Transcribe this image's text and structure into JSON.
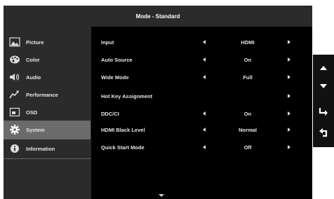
{
  "title": "Mode - Standard",
  "sidebar": {
    "items": [
      {
        "label": "Picture",
        "icon": "picture-icon"
      },
      {
        "label": "Color",
        "icon": "color-palette-icon"
      },
      {
        "label": "Audio",
        "icon": "speaker-icon"
      },
      {
        "label": "Performance",
        "icon": "performance-icon"
      },
      {
        "label": "OSD",
        "icon": "osd-icon"
      },
      {
        "label": "System",
        "icon": "gear-icon",
        "selected": true
      },
      {
        "label": "Information",
        "icon": "info-icon"
      }
    ]
  },
  "settings": [
    {
      "label": "Input",
      "value": "HDMI"
    },
    {
      "label": "Auto Source",
      "value": "On"
    },
    {
      "label": "Wide Mode",
      "value": "Full"
    },
    {
      "label": "Hot Key Assignment",
      "value": ""
    },
    {
      "label": "DDC/CI",
      "value": "On"
    },
    {
      "label": "HDMI Black Level",
      "value": "Normal"
    },
    {
      "label": "Quick Start Mode",
      "value": "Off"
    }
  ],
  "keys": [
    "up-arrow-icon",
    "down-arrow-icon",
    "enter-icon",
    "return-icon"
  ],
  "colors": {
    "selected_bg": "#6b6b6b",
    "panel_bg": "#2b2b2b",
    "text": "#e6e6e6"
  }
}
